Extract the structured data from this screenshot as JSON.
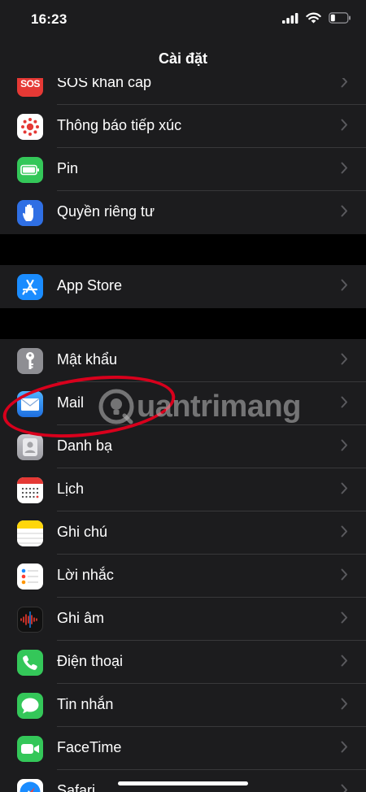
{
  "status_bar": {
    "time": "16:23"
  },
  "nav": {
    "title": "Cài đặt"
  },
  "sections": [
    {
      "rows": [
        {
          "label": "SOS khẩn cấp",
          "icon": "sos-icon",
          "icon_text": "SOS",
          "color": "#e53935"
        },
        {
          "label": "Thông báo tiếp xúc",
          "icon": "exposure-notification-icon",
          "color": "#ffffff"
        },
        {
          "label": "Pin",
          "icon": "battery-icon",
          "color": "#34c759"
        },
        {
          "label": "Quyền riêng tư",
          "icon": "privacy-hand-icon",
          "color": "#2f6fe4"
        }
      ]
    },
    {
      "rows": [
        {
          "label": "App Store",
          "icon": "app-store-icon",
          "color": "#1a8cff"
        }
      ]
    },
    {
      "rows": [
        {
          "label": "Mật khẩu",
          "icon": "key-icon",
          "color": "#8e8e93"
        },
        {
          "label": "Mail",
          "icon": "mail-icon",
          "color": "#1f8ef1"
        },
        {
          "label": "Danh bạ",
          "icon": "contacts-icon",
          "color": "#a8a8ad"
        },
        {
          "label": "Lịch",
          "icon": "calendar-icon",
          "color": "#ffffff"
        },
        {
          "label": "Ghi chú",
          "icon": "notes-icon",
          "color": "#ffd60a"
        },
        {
          "label": "Lời nhắc",
          "icon": "reminders-icon",
          "color": "#ffffff"
        },
        {
          "label": "Ghi âm",
          "icon": "voice-memos-icon",
          "color": "#1c1c1e"
        },
        {
          "label": "Điện thoại",
          "icon": "phone-icon",
          "color": "#34c759"
        },
        {
          "label": "Tin nhắn",
          "icon": "messages-icon",
          "color": "#34c759"
        },
        {
          "label": "FaceTime",
          "icon": "facetime-icon",
          "color": "#34c759"
        },
        {
          "label": "Safari",
          "icon": "safari-icon",
          "color": "#1a8cff"
        }
      ]
    }
  ],
  "watermark": {
    "text": "uantrimang"
  },
  "annotation_color": "#d8001c"
}
